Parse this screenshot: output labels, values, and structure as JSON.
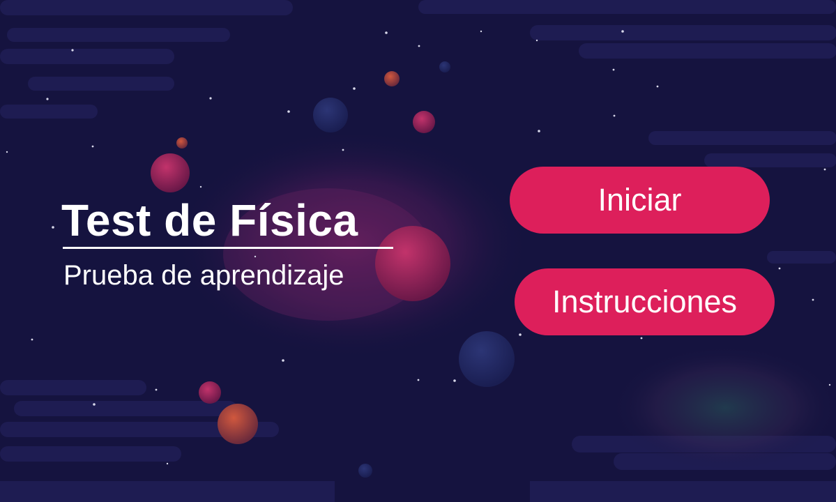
{
  "title": "Test de Física",
  "subtitle": "Prueba de aprendizaje",
  "buttons": {
    "start_label": "Iniciar",
    "instructions_label": "Instrucciones"
  },
  "colors": {
    "background": "#15133f",
    "button": "#dd1f5b",
    "text": "#ffffff"
  }
}
